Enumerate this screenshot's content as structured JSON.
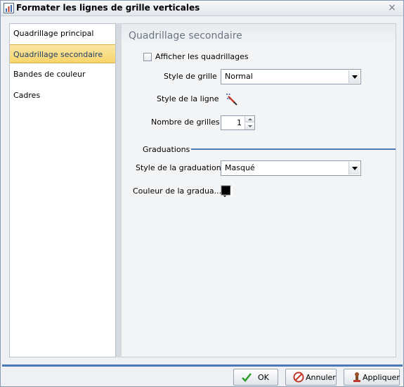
{
  "window": {
    "title": "Formater les lignes de grille verticales",
    "close_glyph": "×"
  },
  "nav": {
    "items": [
      {
        "label": "Quadrillage principal",
        "selected": false
      },
      {
        "label": "Quadrillage secondaire",
        "selected": true
      },
      {
        "label": "Bandes de couleur",
        "selected": false
      },
      {
        "label": "Cadres",
        "selected": false
      }
    ]
  },
  "panel": {
    "title": "Quadrillage secondaire",
    "show_grids": {
      "label": "Afficher les quadrillages",
      "checked": false
    },
    "grid_style": {
      "label": "Style de grille",
      "value": "Normal"
    },
    "line_style": {
      "label": "Style de la ligne",
      "icon": "pen-style-icon"
    },
    "grid_count": {
      "label": "Nombre de grilles",
      "value": "1"
    },
    "graduations": {
      "group_label": "Graduations",
      "style": {
        "label": "Style de la graduation",
        "value": "Masqué"
      },
      "color": {
        "label": "Couleur de la gradua...",
        "value": "#000000"
      }
    }
  },
  "buttons": {
    "ok": "OK",
    "cancel": "Annuler",
    "apply": "Appliquer"
  },
  "colors": {
    "accent": "#4a79b8",
    "selection": "#f7d46b"
  }
}
